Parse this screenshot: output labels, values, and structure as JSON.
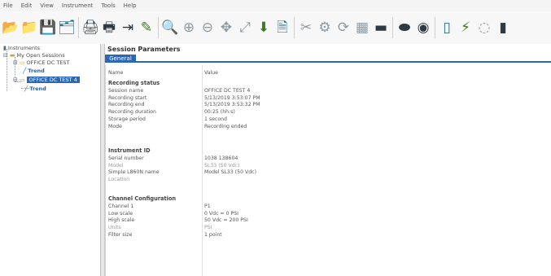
{
  "menu": [
    "File",
    "Edit",
    "View",
    "Instrument",
    "Tools",
    "Help"
  ],
  "toolbar": {
    "icons": [
      {
        "name": "open-folder-icon",
        "glyph": "📂"
      },
      {
        "name": "open-session-icon",
        "glyph": "📁"
      },
      {
        "name": "save-icon",
        "glyph": "💾"
      },
      {
        "name": "save-as-icon",
        "glyph": "🗂"
      },
      {
        "name": "print-icon",
        "glyph": "🖨"
      },
      {
        "name": "print-setup-icon",
        "glyph": "🖶"
      },
      {
        "name": "export-icon",
        "glyph": "⇥"
      },
      {
        "name": "annotate-icon",
        "glyph": "✎"
      },
      {
        "name": "zoom-icon",
        "glyph": "🔍"
      },
      {
        "name": "zoom-in-icon",
        "glyph": "⊕"
      },
      {
        "name": "zoom-out-icon",
        "glyph": "⊖"
      },
      {
        "name": "zoom-fit-icon",
        "glyph": "✥"
      },
      {
        "name": "zoom-reset-icon",
        "glyph": "⤢"
      },
      {
        "name": "download-icon",
        "glyph": "⬇"
      },
      {
        "name": "report-icon",
        "glyph": "🗎"
      },
      {
        "name": "tools-icon",
        "glyph": "✂"
      },
      {
        "name": "settings-icon",
        "glyph": "⚙"
      },
      {
        "name": "sync-icon",
        "glyph": "⟳"
      },
      {
        "name": "channel-icon",
        "glyph": "▦"
      },
      {
        "name": "folder-icon",
        "glyph": "▬"
      },
      {
        "name": "battery-icon",
        "glyph": "⬬"
      },
      {
        "name": "disc-icon",
        "glyph": "◉"
      },
      {
        "name": "instrument-icon",
        "glyph": "▯"
      },
      {
        "name": "connect-icon",
        "glyph": "⚡"
      },
      {
        "name": "progress-icon",
        "glyph": "◌"
      },
      {
        "name": "status-icon",
        "glyph": "▮"
      }
    ]
  },
  "tree": {
    "instruments": "Instruments",
    "open_sessions": "My Open Sessions",
    "session": "OFFICE DC TEST",
    "trend_1": "Trend",
    "selected": "OFFICE DC TEST 4",
    "trend_2": "Trend"
  },
  "panel": {
    "title": "Session Parameters",
    "tab": "General"
  },
  "header": {
    "name": "Name",
    "value": "Value"
  },
  "sections": {
    "recording": {
      "title": "Recording status",
      "rows": [
        {
          "k": "Session name",
          "v": "OFFICE DC TEST 4"
        },
        {
          "k": "Recording start",
          "v": "5/13/2019 3:53:07 PM"
        },
        {
          "k": "Recording end",
          "v": "5/13/2019 3:53:32 PM"
        },
        {
          "k": "Recording duration",
          "v": "00:25 (hh:s)"
        },
        {
          "k": "Storage period",
          "v": "1 second"
        },
        {
          "k": "Mode",
          "v": "Recording ended"
        }
      ]
    },
    "instrument": {
      "title": "Instrument ID",
      "rows": [
        {
          "k": "Serial number",
          "v": "1038 138604"
        },
        {
          "k": "Model",
          "v": "SL33 (50 Vdc)"
        },
        {
          "k": "Simple L860N name",
          "v": "Model SL33 (50 Vdc)"
        },
        {
          "k": "Location",
          "v": ""
        }
      ]
    },
    "channel": {
      "title": "Channel Configuration",
      "rows": [
        {
          "k": "Channel 1",
          "v": "P1"
        },
        {
          "k": "Low scale",
          "v": "0 Vdc = 0 PSI"
        },
        {
          "k": "High scale",
          "v": "50 Vdc = 200 PSI"
        },
        {
          "k": "Units",
          "v": "PSI"
        },
        {
          "k": "Filter size",
          "v": "1 point"
        }
      ]
    }
  }
}
